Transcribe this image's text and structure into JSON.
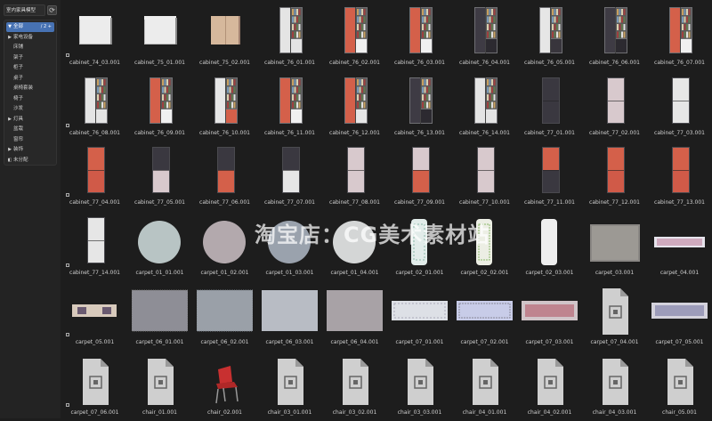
{
  "sidebar": {
    "library_name": "室内家具模型",
    "refresh_icon": "refresh-icon",
    "categories": [
      {
        "label": "全部",
        "selected": true,
        "nums": "/ 2 +"
      },
      {
        "label": "家电设备",
        "expandable": true
      },
      {
        "label": "床铺"
      },
      {
        "label": "架子"
      },
      {
        "label": "柜子"
      },
      {
        "label": "桌子"
      },
      {
        "label": "桌椅套装"
      },
      {
        "label": "椅子"
      },
      {
        "label": "沙发"
      },
      {
        "label": "灯具",
        "expandable": true
      },
      {
        "label": "盆栽"
      },
      {
        "label": "窗帘"
      },
      {
        "label": "装饰",
        "expandable": true
      },
      {
        "label": "未分配",
        "icon": "unassigned-icon"
      }
    ]
  },
  "assets": [
    {
      "name": "cabinet_74_03.001",
      "kind": "white2"
    },
    {
      "name": "cabinet_75_01.001",
      "kind": "white2"
    },
    {
      "name": "cabinet_75_02.001",
      "kind": "beige"
    },
    {
      "name": "cabinet_76_01.001",
      "kind": "shelfW"
    },
    {
      "name": "cabinet_76_02.001",
      "kind": "shelfR"
    },
    {
      "name": "cabinet_76_03.001",
      "kind": "shelfR"
    },
    {
      "name": "cabinet_76_04.001",
      "kind": "shelfD"
    },
    {
      "name": "cabinet_76_05.001",
      "kind": "shelfWD"
    },
    {
      "name": "cabinet_76_06.001",
      "kind": "shelfD"
    },
    {
      "name": "cabinet_76_07.001",
      "kind": "shelfR"
    },
    {
      "name": "cabinet_76_08.001",
      "kind": "shelfW"
    },
    {
      "name": "cabinet_76_09.001",
      "kind": "shelfR"
    },
    {
      "name": "cabinet_76_10.001",
      "kind": "shelfWR"
    },
    {
      "name": "cabinet_76_11.001",
      "kind": "shelfR"
    },
    {
      "name": "cabinet_76_12.001",
      "kind": "shelfRW"
    },
    {
      "name": "cabinet_76_13.001",
      "kind": "shelfD"
    },
    {
      "name": "cabinet_76_14.001",
      "kind": "shelfW"
    },
    {
      "name": "cabinet_77_01.001",
      "kind": "tallD"
    },
    {
      "name": "cabinet_77_02.001",
      "kind": "tallP"
    },
    {
      "name": "cabinet_77_03.001",
      "kind": "tallW"
    },
    {
      "name": "cabinet_77_04.001",
      "kind": "tallR"
    },
    {
      "name": "cabinet_77_05.001",
      "kind": "tallDP"
    },
    {
      "name": "cabinet_77_06.001",
      "kind": "tallDR"
    },
    {
      "name": "cabinet_77_07.001",
      "kind": "tallDW"
    },
    {
      "name": "cabinet_77_08.001",
      "kind": "tallP"
    },
    {
      "name": "cabinet_77_09.001",
      "kind": "tallPR"
    },
    {
      "name": "cabinet_77_10.001",
      "kind": "tallP"
    },
    {
      "name": "cabinet_77_11.001",
      "kind": "tallRD"
    },
    {
      "name": "cabinet_77_12.001",
      "kind": "tallR"
    },
    {
      "name": "cabinet_77_13.001",
      "kind": "tallR"
    },
    {
      "name": "cabinet_77_14.001",
      "kind": "tallW"
    },
    {
      "name": "carpet_01_01.001",
      "kind": "round1"
    },
    {
      "name": "carpet_01_02.001",
      "kind": "round2"
    },
    {
      "name": "carpet_01_03.001",
      "kind": "round3"
    },
    {
      "name": "carpet_01_04.001",
      "kind": "round4"
    },
    {
      "name": "carpet_02_01.001",
      "kind": "runnerV1"
    },
    {
      "name": "carpet_02_02.001",
      "kind": "runnerV2"
    },
    {
      "name": "carpet_02_03.001",
      "kind": "runnerV3"
    },
    {
      "name": "carpet_03.001",
      "kind": "squareGrey"
    },
    {
      "name": "carpet_04.001",
      "kind": "persianH"
    },
    {
      "name": "carpet_05.001",
      "kind": "persianSmall"
    },
    {
      "name": "carpet_06_01.001",
      "kind": "stripe1"
    },
    {
      "name": "carpet_06_02.001",
      "kind": "stripe2"
    },
    {
      "name": "carpet_06_03.001",
      "kind": "stripe3"
    },
    {
      "name": "carpet_06_04.001",
      "kind": "stripe4"
    },
    {
      "name": "carpet_07_01.001",
      "kind": "runH1"
    },
    {
      "name": "carpet_07_02.001",
      "kind": "runH2"
    },
    {
      "name": "carpet_07_03.001",
      "kind": "runH3"
    },
    {
      "name": "carpet_07_04.001",
      "kind": "doc"
    },
    {
      "name": "carpet_07_05.001",
      "kind": "runH4"
    },
    {
      "name": "carpet_07_06.001",
      "kind": "doc"
    },
    {
      "name": "chair_01.001",
      "kind": "doc"
    },
    {
      "name": "chair_02.001",
      "kind": "chair"
    },
    {
      "name": "chair_03_01.001",
      "kind": "doc"
    },
    {
      "name": "chair_03_02.001",
      "kind": "doc"
    },
    {
      "name": "chair_03_03.001",
      "kind": "doc"
    },
    {
      "name": "chair_04_01.001",
      "kind": "doc"
    },
    {
      "name": "chair_04_02.001",
      "kind": "doc"
    },
    {
      "name": "chair_04_03.001",
      "kind": "doc"
    },
    {
      "name": "chair_05.001",
      "kind": "doc"
    }
  ],
  "watermark": "淘宝店：CG美术素材站",
  "colors": {
    "red": "#d4604a",
    "white": "#e2e2e2",
    "dark": "#3a3a40",
    "pink": "#d8c9cd",
    "beige": "#d6b89c",
    "selected": "#4772b3"
  }
}
